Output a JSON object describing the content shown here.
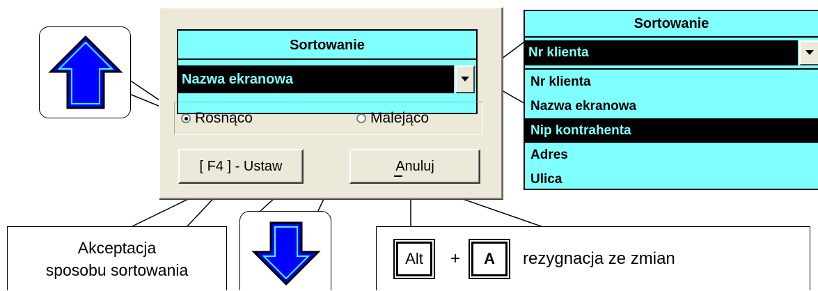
{
  "dialog": {
    "sort_title": "Sortowanie",
    "sort_value": "Nazwa ekranowa",
    "radio_asc": "Rosnąco",
    "radio_desc": "Malejąco",
    "radio_selected": "asc",
    "btn_set": "[ F4 ] - Ustaw",
    "btn_cancel": "Anuluj"
  },
  "dropdown": {
    "title": "Sortowanie",
    "current": "Nr klienta",
    "options": [
      "Nr klienta",
      "Nazwa ekranowa",
      "Nip kontrahenta",
      "Adres",
      "Ulica"
    ],
    "selected_index": 2
  },
  "callouts": {
    "accept_line1": "Akceptacja",
    "accept_line2": "sposobu sortowania",
    "key_alt": "Alt",
    "plus": "+",
    "key_a": "A",
    "cancel_text": "rezygnacja ze zmian"
  },
  "colors": {
    "cyan": "#80ffff",
    "arrow_blue": "#0000ff",
    "dialog_bg": "#ece9d8"
  },
  "icons": [
    "arrow-up-icon",
    "arrow-down-icon",
    "combo-arrow-icon"
  ]
}
